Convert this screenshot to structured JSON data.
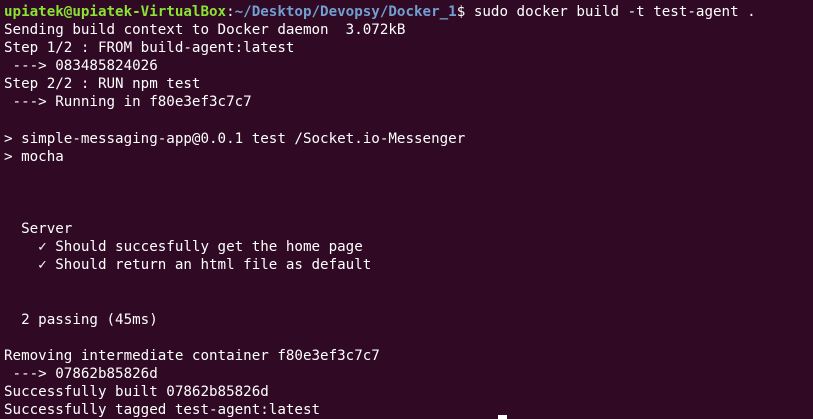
{
  "prompt": {
    "user_host": "upiatek@upiatek-VirtualBox",
    "sep": ":",
    "cwd": "~/Desktop/Devopsy/Docker_1",
    "symbol": "$",
    "command": " sudo docker build -t test-agent ."
  },
  "output_lines": [
    "Sending build context to Docker daemon  3.072kB",
    "Step 1/2 : FROM build-agent:latest",
    " ---> 083485824026",
    "Step 2/2 : RUN npm test",
    " ---> Running in f80e3ef3c7c7",
    "",
    "> simple-messaging-app@0.0.1 test /Socket.io-Messenger",
    "> mocha",
    "",
    "",
    "",
    "  Server",
    "    ✓ Should succesfully get the home page",
    "    ✓ Should return an html file as default",
    "",
    "",
    "  2 passing (45ms)",
    "",
    "Removing intermediate container f80e3ef3c7c7",
    " ---> 07862b85826d",
    "Successfully built 07862b85826d",
    "Successfully tagged test-agent:latest"
  ],
  "colors": {
    "background": "#300a24",
    "text": "#ffffff",
    "prompt_user": "#8ae234",
    "prompt_path": "#729fcf"
  }
}
